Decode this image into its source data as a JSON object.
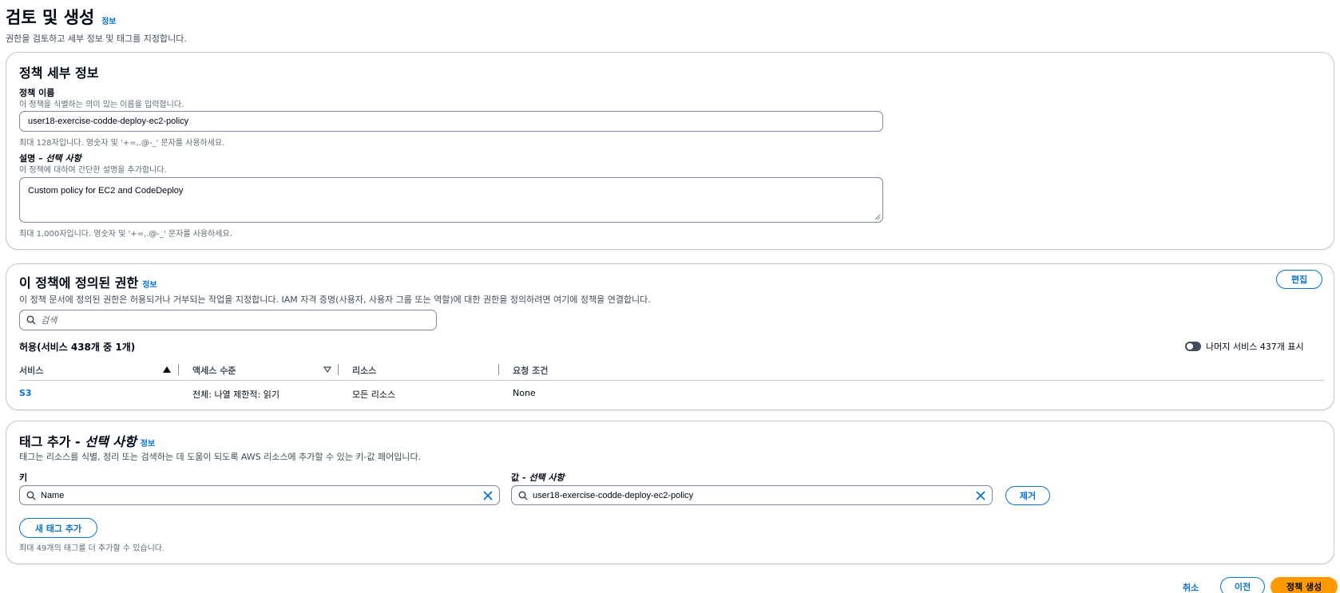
{
  "header": {
    "title": "검토 및 생성",
    "info": "정보",
    "subtitle": "권한을 검토하고 세부 정보 및 태그를 지정합니다."
  },
  "details": {
    "title": "정책 세부 정보",
    "name_label": "정책 이름",
    "name_hint": "이 정책을 식별하는 의미 있는 이름을 입력합니다.",
    "name_value": "user18-exercise-codde-deploy-ec2-policy",
    "name_constraint": "최대 128자입니다. 영숫자 및 '+=,.@-_' 문자를 사용하세요.",
    "desc_label_main": "설명 – ",
    "desc_label_optional": "선택 사항",
    "desc_hint": "이 정책에 대하여 간단한 설명을 추가합니다.",
    "desc_value": "Custom policy for EC2 and CodeDeploy",
    "desc_constraint": "최대 1,000자입니다. 영숫자 및 '+=,.@-_' 문자를 사용하세요."
  },
  "permissions": {
    "title": "이 정책에 정의된 권한",
    "info": "정보",
    "edit_label": "편집",
    "description": "이 정책 문서에 정의된 권한은 허용되거나 거부되는 작업을 지정합니다. IAM 자격 증명(사용자, 사용자 그룹 또는 역할)에 대한 권한을 정의하려면 여기에 정책을 연결합니다.",
    "search_placeholder": "검색",
    "table_heading": "허용(서비스 438개 중 1개)",
    "toggle_label": "나머지 서비스 437개 표시",
    "columns": [
      "서비스",
      "액세스 수준",
      "리소스",
      "요청 조건"
    ],
    "rows": [
      {
        "service": "S3",
        "access": "전체: 나열 제한적: 읽기",
        "resource": "모든 리소스",
        "condition": "None"
      }
    ]
  },
  "tags": {
    "title_main": "태그 추가 - ",
    "title_optional": "선택 사항",
    "info": "정보",
    "description": "태그는 리소스를 식별, 정리 또는 검색하는 데 도움이 되도록 AWS 리소스에 추가할 수 있는 키-값 페어입니다.",
    "key_label": "키",
    "value_label_main": "값 - ",
    "value_label_optional": "선택 사항",
    "key_value": "Name",
    "value_value": "user18-exercise-codde-deploy-ec2-policy",
    "remove_label": "제거",
    "add_label": "새 태그 추가",
    "constraint": "최대 49개의 태그를 더 추가할 수 있습니다."
  },
  "footer": {
    "cancel_label": "취소",
    "previous_label": "이전",
    "create_label": "정책 생성"
  },
  "colors": {
    "link": "#0972d3",
    "primary": "#ff9900",
    "border": "#c6c6cd"
  }
}
